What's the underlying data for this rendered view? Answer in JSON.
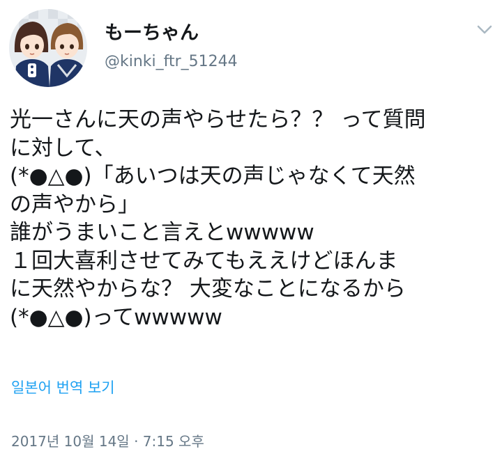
{
  "author": {
    "display_name": "もーちゃん",
    "handle": "@kinki_ftr_51244",
    "avatar_icon": "avatar-illustration"
  },
  "menu_icon": "chevron-down-icon",
  "tweet": {
    "lines": [
      "光一さんに天の声やらせたら？？ って質問",
      "に対して、",
      "(*●△●)「あいつは天の声じゃなくて天然",
      "の声やから」",
      "誰がうまいこと言えとwwwww",
      "１回大喜利させてみてもええけどほんま",
      "に天然やからな？ 大変なことになるから",
      "(*●△●)ってwwwww"
    ]
  },
  "translate_link": "일본어 번역 보기",
  "timestamp": "2017년 10월 14일 · 7:15 오후",
  "colors": {
    "text": "#14171a",
    "secondary": "#657786",
    "link": "#1da1f2",
    "background": "#ffffff"
  }
}
